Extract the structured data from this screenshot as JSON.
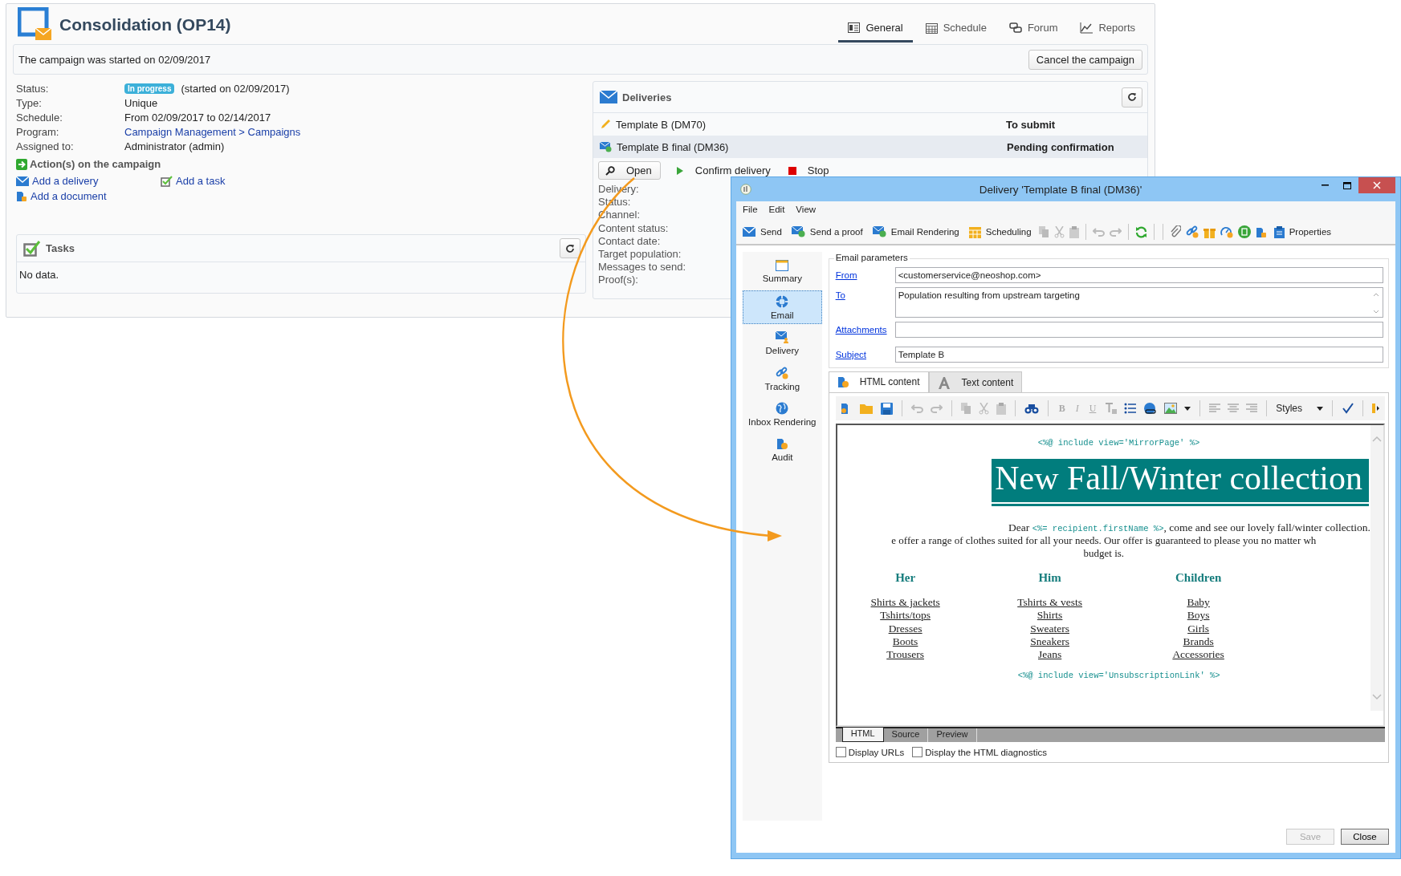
{
  "page": {
    "title": "Consolidation (OP14)",
    "tabs": [
      {
        "label": "General",
        "kind": "general",
        "selected": true
      },
      {
        "label": "Schedule",
        "kind": "schedule",
        "selected": false
      },
      {
        "label": "Forum",
        "kind": "forum",
        "selected": false
      },
      {
        "label": "Reports",
        "kind": "reports",
        "selected": false
      }
    ],
    "notice": "The campaign was started on 02/09/2017",
    "cancel_button": "Cancel the campaign",
    "details": [
      {
        "label": "Status:",
        "kind": "status",
        "badge": "In progress",
        "value": "(started on 02/09/2017)"
      },
      {
        "label": "Type:",
        "kind": "text",
        "value": "Unique"
      },
      {
        "label": "Schedule:",
        "kind": "text",
        "value": "From 02/09/2017 to 02/14/2017"
      },
      {
        "label": "Program:",
        "kind": "link",
        "value": "Campaign Management > Campaigns"
      },
      {
        "label": "Assigned to:",
        "kind": "text",
        "value": "Administrator (admin)"
      }
    ],
    "actions": {
      "title": "Action(s) on the campaign",
      "links": [
        {
          "label": "Add a delivery",
          "kind": "delivery"
        },
        {
          "label": "Add a task",
          "kind": "task"
        },
        {
          "label": "Add a document",
          "kind": "document"
        }
      ]
    },
    "tasks": {
      "title": "Tasks",
      "empty": "No data."
    },
    "deliveries": {
      "title": "Deliveries",
      "rows": [
        {
          "name": "Template B (DM70)",
          "status": "To submit",
          "kind": "draft",
          "selected": false
        },
        {
          "name": "Template B final (DM36)",
          "status": "Pending confirmation",
          "kind": "pending",
          "selected": true
        }
      ],
      "actions": [
        {
          "label": "Open",
          "kind": "open"
        },
        {
          "label": "Confirm delivery",
          "kind": "confirm"
        },
        {
          "label": "Stop",
          "kind": "stop"
        }
      ],
      "fields": [
        "Delivery:",
        "Status:",
        "Channel:",
        "Content status:",
        "Contact date:",
        "Target population:",
        "Messages to send:",
        "Proof(s):"
      ]
    }
  },
  "dialog": {
    "title": "Delivery 'Template B final (DM36)'",
    "menu": [
      "File",
      "Edit",
      "View"
    ],
    "toolbar": [
      {
        "label": "Send",
        "kind": "send"
      },
      {
        "label": "Send a proof",
        "kind": "proof"
      },
      {
        "label": "Email Rendering",
        "kind": "rendering"
      },
      {
        "label": "Scheduling",
        "kind": "scheduling"
      }
    ],
    "properties_button": "Properties",
    "nav": [
      {
        "label": "Summary",
        "kind": "summary",
        "selected": false
      },
      {
        "label": "Email",
        "kind": "email",
        "selected": true
      },
      {
        "label": "Delivery",
        "kind": "delivery",
        "selected": false
      },
      {
        "label": "Tracking",
        "kind": "tracking",
        "selected": false
      },
      {
        "label": "Inbox Rendering",
        "kind": "inbox",
        "selected": false
      },
      {
        "label": "Audit",
        "kind": "audit",
        "selected": false
      }
    ],
    "email_parameters": {
      "title": "Email parameters",
      "fields": [
        {
          "label": "From",
          "kind": "line",
          "value": "<customerservice@neoshop.com>"
        },
        {
          "label": "To",
          "kind": "area",
          "value": "Population resulting from upstream targeting"
        },
        {
          "label": "Attachments",
          "kind": "line"
        },
        {
          "label": "Subject",
          "kind": "line",
          "value": "Template B"
        }
      ]
    },
    "content_tabs": [
      {
        "label": "HTML content",
        "kind": "html",
        "selected": true
      },
      {
        "label": "Text content",
        "kind": "text",
        "selected": false
      }
    ],
    "format_buttons": [
      "B",
      "I",
      "U"
    ],
    "styles_dropdown": "Styles",
    "preview": {
      "header_include": "<%@ include view='MirrorPage' %>",
      "heading": "New Fall/Winter collection",
      "greeting": {
        "before": "Dear ",
        "code": "<%= recipient.firstName %>",
        "after": ", come and see our lovely fall/winter collection."
      },
      "body_lines": [
        "e offer a range of clothes suited for all your needs. Our offer is guaranteed to please you no matter wh",
        "budget is."
      ],
      "columns": [
        {
          "title": "Her",
          "links": [
            "Shirts & jackets",
            "Tshirts/tops",
            "Dresses",
            "Boots",
            "Trousers"
          ]
        },
        {
          "title": "Him",
          "links": [
            "Tshirts & vests",
            "Shirts",
            "Sweaters",
            "Sneakers",
            "Jeans"
          ]
        },
        {
          "title": "Children",
          "links": [
            "Baby",
            "Boys",
            "Girls",
            "Brands",
            "Accessories"
          ]
        }
      ],
      "footer_include": "<%@ include view='UnsubscriptionLink' %>"
    },
    "view_tabs": [
      {
        "label": "HTML",
        "selected": true
      },
      {
        "label": "Source",
        "selected": false
      },
      {
        "label": "Preview",
        "selected": false
      }
    ],
    "options": [
      {
        "label": "Display URLs",
        "checked": false
      },
      {
        "label": "Display the HTML diagnostics",
        "checked": false
      }
    ],
    "buttons": [
      {
        "label": "Save",
        "disabled": true
      },
      {
        "label": "Close",
        "disabled": false
      }
    ]
  }
}
